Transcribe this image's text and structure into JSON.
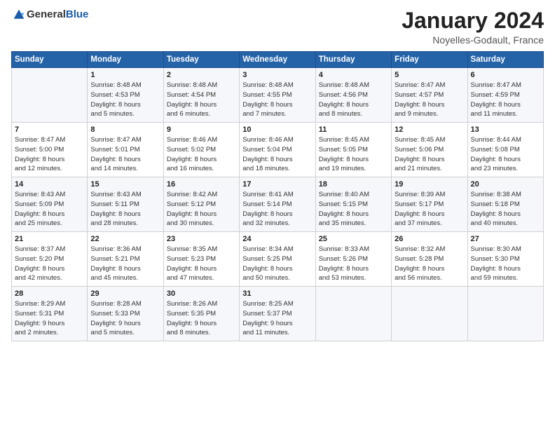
{
  "header": {
    "logo": {
      "general": "General",
      "blue": "Blue"
    },
    "title": "January 2024",
    "subtitle": "Noyelles-Godault, France"
  },
  "calendar": {
    "days_of_week": [
      "Sunday",
      "Monday",
      "Tuesday",
      "Wednesday",
      "Thursday",
      "Friday",
      "Saturday"
    ],
    "weeks": [
      [
        {
          "day": "",
          "info": ""
        },
        {
          "day": "1",
          "info": "Sunrise: 8:48 AM\nSunset: 4:53 PM\nDaylight: 8 hours\nand 5 minutes."
        },
        {
          "day": "2",
          "info": "Sunrise: 8:48 AM\nSunset: 4:54 PM\nDaylight: 8 hours\nand 6 minutes."
        },
        {
          "day": "3",
          "info": "Sunrise: 8:48 AM\nSunset: 4:55 PM\nDaylight: 8 hours\nand 7 minutes."
        },
        {
          "day": "4",
          "info": "Sunrise: 8:48 AM\nSunset: 4:56 PM\nDaylight: 8 hours\nand 8 minutes."
        },
        {
          "day": "5",
          "info": "Sunrise: 8:47 AM\nSunset: 4:57 PM\nDaylight: 8 hours\nand 9 minutes."
        },
        {
          "day": "6",
          "info": "Sunrise: 8:47 AM\nSunset: 4:59 PM\nDaylight: 8 hours\nand 11 minutes."
        }
      ],
      [
        {
          "day": "7",
          "info": "Sunrise: 8:47 AM\nSunset: 5:00 PM\nDaylight: 8 hours\nand 12 minutes."
        },
        {
          "day": "8",
          "info": "Sunrise: 8:47 AM\nSunset: 5:01 PM\nDaylight: 8 hours\nand 14 minutes."
        },
        {
          "day": "9",
          "info": "Sunrise: 8:46 AM\nSunset: 5:02 PM\nDaylight: 8 hours\nand 16 minutes."
        },
        {
          "day": "10",
          "info": "Sunrise: 8:46 AM\nSunset: 5:04 PM\nDaylight: 8 hours\nand 18 minutes."
        },
        {
          "day": "11",
          "info": "Sunrise: 8:45 AM\nSunset: 5:05 PM\nDaylight: 8 hours\nand 19 minutes."
        },
        {
          "day": "12",
          "info": "Sunrise: 8:45 AM\nSunset: 5:06 PM\nDaylight: 8 hours\nand 21 minutes."
        },
        {
          "day": "13",
          "info": "Sunrise: 8:44 AM\nSunset: 5:08 PM\nDaylight: 8 hours\nand 23 minutes."
        }
      ],
      [
        {
          "day": "14",
          "info": "Sunrise: 8:43 AM\nSunset: 5:09 PM\nDaylight: 8 hours\nand 25 minutes."
        },
        {
          "day": "15",
          "info": "Sunrise: 8:43 AM\nSunset: 5:11 PM\nDaylight: 8 hours\nand 28 minutes."
        },
        {
          "day": "16",
          "info": "Sunrise: 8:42 AM\nSunset: 5:12 PM\nDaylight: 8 hours\nand 30 minutes."
        },
        {
          "day": "17",
          "info": "Sunrise: 8:41 AM\nSunset: 5:14 PM\nDaylight: 8 hours\nand 32 minutes."
        },
        {
          "day": "18",
          "info": "Sunrise: 8:40 AM\nSunset: 5:15 PM\nDaylight: 8 hours\nand 35 minutes."
        },
        {
          "day": "19",
          "info": "Sunrise: 8:39 AM\nSunset: 5:17 PM\nDaylight: 8 hours\nand 37 minutes."
        },
        {
          "day": "20",
          "info": "Sunrise: 8:38 AM\nSunset: 5:18 PM\nDaylight: 8 hours\nand 40 minutes."
        }
      ],
      [
        {
          "day": "21",
          "info": "Sunrise: 8:37 AM\nSunset: 5:20 PM\nDaylight: 8 hours\nand 42 minutes."
        },
        {
          "day": "22",
          "info": "Sunrise: 8:36 AM\nSunset: 5:21 PM\nDaylight: 8 hours\nand 45 minutes."
        },
        {
          "day": "23",
          "info": "Sunrise: 8:35 AM\nSunset: 5:23 PM\nDaylight: 8 hours\nand 47 minutes."
        },
        {
          "day": "24",
          "info": "Sunrise: 8:34 AM\nSunset: 5:25 PM\nDaylight: 8 hours\nand 50 minutes."
        },
        {
          "day": "25",
          "info": "Sunrise: 8:33 AM\nSunset: 5:26 PM\nDaylight: 8 hours\nand 53 minutes."
        },
        {
          "day": "26",
          "info": "Sunrise: 8:32 AM\nSunset: 5:28 PM\nDaylight: 8 hours\nand 56 minutes."
        },
        {
          "day": "27",
          "info": "Sunrise: 8:30 AM\nSunset: 5:30 PM\nDaylight: 8 hours\nand 59 minutes."
        }
      ],
      [
        {
          "day": "28",
          "info": "Sunrise: 8:29 AM\nSunset: 5:31 PM\nDaylight: 9 hours\nand 2 minutes."
        },
        {
          "day": "29",
          "info": "Sunrise: 8:28 AM\nSunset: 5:33 PM\nDaylight: 9 hours\nand 5 minutes."
        },
        {
          "day": "30",
          "info": "Sunrise: 8:26 AM\nSunset: 5:35 PM\nDaylight: 9 hours\nand 8 minutes."
        },
        {
          "day": "31",
          "info": "Sunrise: 8:25 AM\nSunset: 5:37 PM\nDaylight: 9 hours\nand 11 minutes."
        },
        {
          "day": "",
          "info": ""
        },
        {
          "day": "",
          "info": ""
        },
        {
          "day": "",
          "info": ""
        }
      ]
    ]
  }
}
